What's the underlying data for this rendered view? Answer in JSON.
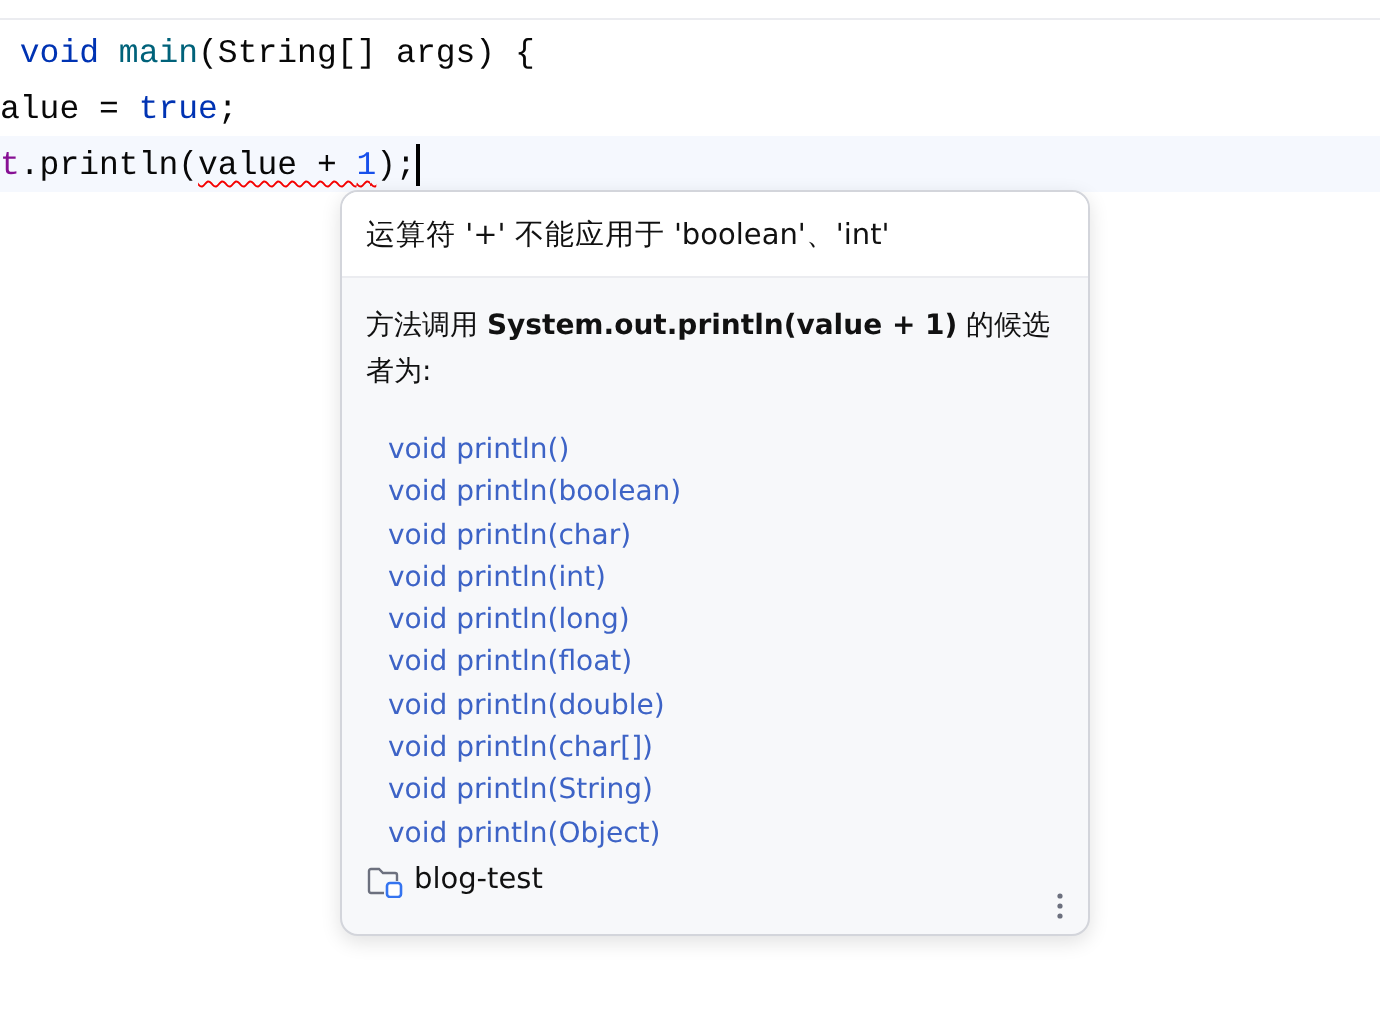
{
  "editor": {
    "lines": [
      {
        "highlighted": false,
        "caret": false,
        "tokens": [
          {
            "text": " void",
            "kind": "keyword"
          },
          {
            "text": " main",
            "kind": "declaration"
          },
          {
            "text": "(String[] args) {",
            "kind": "plain"
          }
        ]
      },
      {
        "highlighted": false,
        "caret": false,
        "tokens": [
          {
            "text": "alue = ",
            "kind": "plain"
          },
          {
            "text": "true",
            "kind": "keyword"
          },
          {
            "text": ";",
            "kind": "plain"
          }
        ]
      },
      {
        "highlighted": true,
        "caret": true,
        "tokens": [
          {
            "text": "t",
            "kind": "field"
          },
          {
            "text": ".println(",
            "kind": "plain"
          },
          {
            "text": "value + ",
            "kind": "plain",
            "error": true
          },
          {
            "text": "1",
            "kind": "number",
            "error": true
          },
          {
            "text": ");",
            "kind": "plain"
          }
        ]
      }
    ]
  },
  "popup": {
    "message": "运算符 '+' 不能应用于 'boolean'、'int'",
    "description": "方法调用 **System.out.println(value + 1)** 的候选者为:",
    "candidates": [
      "void println()",
      "void println(boolean)",
      "void println(char)",
      "void println(int)",
      "void println(long)",
      "void println(float)",
      "void println(double)",
      "void println(char[])",
      "void println(String)",
      "void println(Object)"
    ],
    "module": "blog-test"
  }
}
